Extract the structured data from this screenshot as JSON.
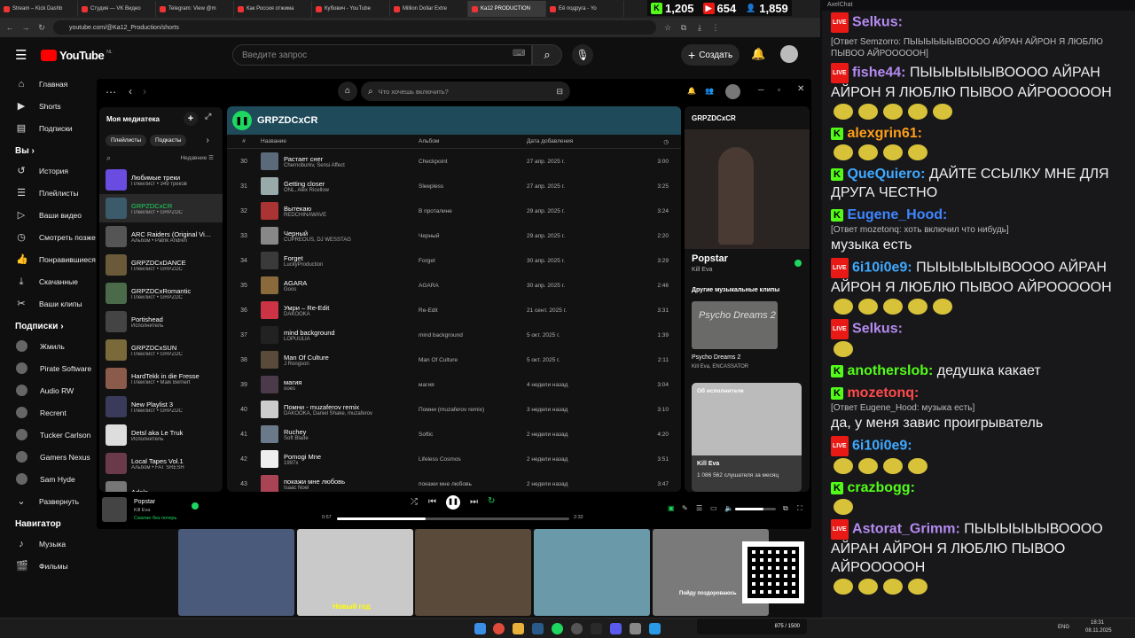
{
  "browser": {
    "tabs": [
      "Stream – Kick Dashb",
      "Студия — VK Видео",
      "Telegram: View @m",
      "Как Россия отжима",
      "Кубович - YouTube",
      "Million Dollar Extre",
      "Ka12 PRODUCTION",
      "Её подруга - Yo"
    ],
    "url": "youtube.com/@Ka12_Production/shorts"
  },
  "stats": {
    "kick": "1,205",
    "vk": "654",
    "viewers": "1,859"
  },
  "youtube": {
    "logo": "YouTube",
    "region": "NL",
    "search_placeholder": "Введите запрос",
    "create_label": "Создать",
    "nav": [
      "Главная",
      "Shorts",
      "Подписки"
    ],
    "you_label": "Вы",
    "you_items": [
      "История",
      "Плейлисты",
      "Ваши видео",
      "Смотреть позже",
      "Понравившиеся",
      "Скачанные",
      "Ваши клипы"
    ],
    "subs_label": "Подписки",
    "subs": [
      "Жмиль",
      "Pirate Software",
      "Audio RW",
      "Recrent",
      "Tucker Carlson",
      "Gamers Nexus",
      "Sam Hyde"
    ],
    "expand": "Развернуть",
    "navigator_label": "Навигатор",
    "navigator_items": [
      "Музыка",
      "Фильмы"
    ]
  },
  "spotify": {
    "search_placeholder": "Что хочешь включить?",
    "library_title": "Моя медиатека",
    "filters": [
      "Плейлисты",
      "Подкасты"
    ],
    "sort_label": "Недавние",
    "library": [
      {
        "title": "Любимые треки",
        "sub": "Плейлист • 349 треков",
        "color": "#6a4de0"
      },
      {
        "title": "GRPZDCxCR",
        "sub": "Плейлист • GRPZDC",
        "color": "#3b5a6a",
        "active": true
      },
      {
        "title": "ARC Raiders (Original Vi…",
        "sub": "Альбом • Patrik Andrén",
        "color": "#555"
      },
      {
        "title": "GRPZDCxDANCE",
        "sub": "Плейлист • GRPZDC",
        "color": "#6a5a3a"
      },
      {
        "title": "GRPZDCxRomantic",
        "sub": "Плейлист • GRPZDC",
        "color": "#4a6a4a"
      },
      {
        "title": "Portishead",
        "sub": "Исполнитель",
        "color": "#444"
      },
      {
        "title": "GRPZDCxSUN",
        "sub": "Плейлист • GRPZDC",
        "color": "#7a6a3a"
      },
      {
        "title": "HardTekk in die Fresse",
        "sub": "Плейлист • Maik Bernert",
        "color": "#8a5a4a"
      },
      {
        "title": "New Playlist 3",
        "sub": "Плейлист • GRPZDC",
        "color": "#3a3a5a"
      },
      {
        "title": "Detsl aka Le Truk",
        "sub": "Исполнитель",
        "color": "#ddd"
      },
      {
        "title": "Local Tapes Vol.1",
        "sub": "Альбом • FAT SRESH",
        "color": "#6a3a4a"
      },
      {
        "title": "Adele",
        "sub": "",
        "color": "#777"
      }
    ],
    "playlist_name": "GRPZDCxCR",
    "columns": {
      "num": "#",
      "title": "Название",
      "album": "Альбом",
      "date": "Дата добавления"
    },
    "tracks": [
      {
        "n": "30",
        "title": "Растает снег",
        "artist": "Chernoburkv, Sensi Affect",
        "album": "Checkpoint",
        "date": "27 апр. 2025 г.",
        "dur": "3:00",
        "color": "#5a6a7a"
      },
      {
        "n": "31",
        "title": "Getting closer",
        "artist": "ONL, Alex Ricellow",
        "album": "Sleepless",
        "date": "27 апр. 2025 г.",
        "dur": "3:25",
        "color": "#9aa"
      },
      {
        "n": "32",
        "title": "Вытекаю",
        "artist": "REDCHINAWAVE",
        "album": "В проталине",
        "date": "29 апр. 2025 г.",
        "dur": "3:24",
        "color": "#a33"
      },
      {
        "n": "33",
        "title": "Черный",
        "artist": "CUPREOUS, DJ WESSTAG",
        "album": "Черный",
        "date": "29 апр. 2025 г.",
        "dur": "2:20",
        "color": "#888"
      },
      {
        "n": "34",
        "title": "Forget",
        "artist": "LuckyProduction",
        "album": "Forget",
        "date": "30 апр. 2025 г.",
        "dur": "3:29",
        "color": "#3a3a3a"
      },
      {
        "n": "35",
        "title": "AGARA",
        "artist": "Goos",
        "album": "AGARA",
        "date": "30 апр. 2025 г.",
        "dur": "2:46",
        "color": "#8a6a3a"
      },
      {
        "n": "36",
        "title": "Умри – Re-Edit",
        "artist": "DAKOOKA",
        "album": "Re-Edit",
        "date": "21 сент. 2025 г.",
        "dur": "3:31",
        "color": "#c34"
      },
      {
        "n": "37",
        "title": "mind background",
        "artist": "LOPUULIA",
        "album": "mind background",
        "date": "5 окт. 2025 г.",
        "dur": "1:39",
        "color": "#222"
      },
      {
        "n": "38",
        "title": "Man Of Culture",
        "artist": "J Rongson",
        "album": "Man Of Culture",
        "date": "5 окт. 2025 г.",
        "dur": "2:11",
        "color": "#5a4a3a"
      },
      {
        "n": "39",
        "title": "магия",
        "artist": "ooes",
        "album": "магия",
        "date": "4 недели назад",
        "dur": "3:04",
        "color": "#4a3a4a"
      },
      {
        "n": "40",
        "title": "Помни - muzaferov remix",
        "artist": "DAKOOKA, Daniel Shake, muzaferov",
        "album": "Помни (muzaferov remix)",
        "date": "3 недели назад",
        "dur": "3:10",
        "color": "#ccc"
      },
      {
        "n": "41",
        "title": "Ruchey",
        "artist": "Soft Blade",
        "album": "Softic",
        "date": "2 недели назад",
        "dur": "4:20",
        "color": "#6a7a8a"
      },
      {
        "n": "42",
        "title": "Pomogi Mne",
        "artist": "1997x",
        "album": "Lifeless Cosmos",
        "date": "2 недели назад",
        "dur": "3:51",
        "color": "#eee"
      },
      {
        "n": "43",
        "title": "покажи мне любовь",
        "artist": "Isaac Noel",
        "album": "покажи мне любовь",
        "date": "2 недели назад",
        "dur": "3:47",
        "color": "#a45"
      }
    ],
    "right": {
      "header": "GRPZDCxCR",
      "song": "Popstar",
      "artist": "Kill Eva",
      "other_clips": "Другие музыкальные клипы",
      "clip_title": "Psycho Dreams 2",
      "clip_artists": "Kill Eva, ENCASSATOR",
      "about": "Об исполнителе",
      "about_name": "Kill Eva",
      "listeners": "1 086 562 слушателя за месяц"
    },
    "player": {
      "title": "Popstar",
      "artist": "Kill Eva",
      "status": "Сжатие без потерь",
      "elapsed": "0:57",
      "total": "2:32",
      "progress": 0.38,
      "volume": 0.7
    }
  },
  "chat": {
    "header": "AxelChat",
    "messages": [
      {
        "user": "Selkus:",
        "color": "#b58bf0",
        "src": "live",
        "text": ""
      },
      {
        "user": "",
        "color": "#ccc",
        "src": "",
        "reply": "[Ответ Semzorro: ПЫЫЫЫЫЫВОООО АЙРАН АЙРОН Я ЛЮБЛЮ ПЫВОО АЙРОООООН]",
        "text": ""
      },
      {
        "user": "fishe44:",
        "color": "#b58bf0",
        "src": "live",
        "text": "ПЫЫЫЫЫЫВОООО АЙРАН АЙРОН Я ЛЮБЛЮ ПЫВОО АЙРОООООН",
        "emotes": 5
      },
      {
        "user": "alexgrin61:",
        "color": "#ff9f1a",
        "src": "kick",
        "text": "",
        "emotes": 4
      },
      {
        "user": "QueQuiero:",
        "color": "#3fa9ff",
        "src": "kick",
        "text": "ДАЙТЕ ССЫЛКУ МНЕ ДЛЯ ДРУГА ЧЕСТНО"
      },
      {
        "user": "Eugene_Hood:",
        "color": "#3f86ff",
        "src": "kick",
        "reply": "[Ответ mozetonq: хоть включил что нибудь]",
        "text": "музыка есть"
      },
      {
        "user": "6i10i0e9:",
        "color": "#3fa9ff",
        "src": "live",
        "text": "ПЫЫЫЫЫЫВОООО АЙРАН АЙРОН Я ЛЮБЛЮ ПЫВОО АЙРОООООН",
        "emotes": 5
      },
      {
        "user": "Selkus:",
        "color": "#b58bf0",
        "src": "live",
        "text": "",
        "emotes": 1
      },
      {
        "user": "anotherslob:",
        "color": "#53fc18",
        "src": "kick",
        "text": "дедушка какает"
      },
      {
        "user": "mozetonq:",
        "color": "#ff4a4a",
        "src": "kick",
        "reply": "[Ответ Eugene_Hood: музыка есть]",
        "text": "да, у меня завис проигрыватель"
      },
      {
        "user": "6i10i0e9:",
        "color": "#3fa9ff",
        "src": "live",
        "text": "",
        "emotes": 4
      },
      {
        "user": "crazbogg:",
        "color": "#53fc18",
        "src": "kick",
        "text": "",
        "emotes": 1
      },
      {
        "user": "Astorat_Grimm:",
        "color": "#b58bf0",
        "src": "live",
        "text": "ПЫЫЫЫЫЫВОООО АЙРАН АЙРОН Я ЛЮБЛЮ ПЫВОО АЙРОООООН",
        "emotes": 4
      }
    ]
  },
  "shorts": {
    "caption1": "Новый год",
    "caption2": "Пойду поздороваюсь"
  },
  "taskbar": {
    "lang": "ENG",
    "time": "18:31",
    "date": "08.11.2025",
    "promo": "875 / 1500"
  }
}
